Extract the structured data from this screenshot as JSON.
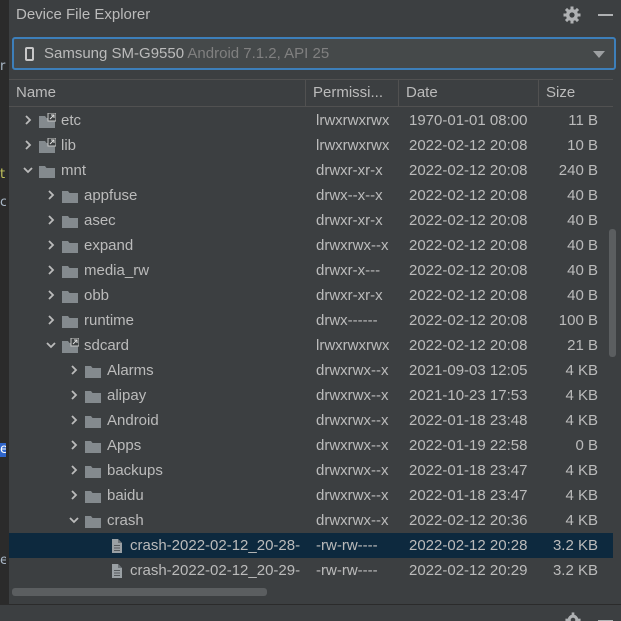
{
  "window": {
    "title": "Device File Explorer"
  },
  "device": {
    "name": "Samsung SM-G9550",
    "os": "Android 7.1.2, API 25"
  },
  "columns": {
    "name": "Name",
    "permissions": "Permissi...",
    "date": "Date",
    "size": "Size"
  },
  "left_strip": {
    "marks": [
      "r",
      "t",
      "c",
      "e",
      "e"
    ]
  },
  "rows": [
    {
      "indent": 0,
      "state": "collapsed",
      "icon": "folder-link-icon",
      "name": "etc",
      "permissions": "lrwxrwxrwx",
      "date": "1970-01-01 08:00",
      "size": "11 B"
    },
    {
      "indent": 0,
      "state": "collapsed",
      "icon": "folder-link-icon",
      "name": "lib",
      "permissions": "lrwxrwxrwx",
      "date": "2022-02-12 20:08",
      "size": "10 B"
    },
    {
      "indent": 0,
      "state": "expanded",
      "icon": "folder-icon",
      "name": "mnt",
      "permissions": "drwxr-xr-x",
      "date": "2022-02-12 20:08",
      "size": "240 B"
    },
    {
      "indent": 1,
      "state": "collapsed",
      "icon": "folder-icon",
      "name": "appfuse",
      "permissions": "drwx--x--x",
      "date": "2022-02-12 20:08",
      "size": "40 B"
    },
    {
      "indent": 1,
      "state": "collapsed",
      "icon": "folder-icon",
      "name": "asec",
      "permissions": "drwxr-xr-x",
      "date": "2022-02-12 20:08",
      "size": "40 B"
    },
    {
      "indent": 1,
      "state": "collapsed",
      "icon": "folder-icon",
      "name": "expand",
      "permissions": "drwxrwx--x",
      "date": "2022-02-12 20:08",
      "size": "40 B"
    },
    {
      "indent": 1,
      "state": "collapsed",
      "icon": "folder-icon",
      "name": "media_rw",
      "permissions": "drwxr-x---",
      "date": "2022-02-12 20:08",
      "size": "40 B"
    },
    {
      "indent": 1,
      "state": "collapsed",
      "icon": "folder-icon",
      "name": "obb",
      "permissions": "drwxr-xr-x",
      "date": "2022-02-12 20:08",
      "size": "40 B"
    },
    {
      "indent": 1,
      "state": "collapsed",
      "icon": "folder-icon",
      "name": "runtime",
      "permissions": "drwx------",
      "date": "2022-02-12 20:08",
      "size": "100 B"
    },
    {
      "indent": 1,
      "state": "expanded",
      "icon": "folder-link-icon",
      "name": "sdcard",
      "permissions": "lrwxrwxrwx",
      "date": "2022-02-12 20:08",
      "size": "21 B"
    },
    {
      "indent": 2,
      "state": "collapsed",
      "icon": "folder-icon",
      "name": "Alarms",
      "permissions": "drwxrwx--x",
      "date": "2021-09-03 12:05",
      "size": "4 KB"
    },
    {
      "indent": 2,
      "state": "collapsed",
      "icon": "folder-icon",
      "name": "alipay",
      "permissions": "drwxrwx--x",
      "date": "2021-10-23 17:53",
      "size": "4 KB"
    },
    {
      "indent": 2,
      "state": "collapsed",
      "icon": "folder-icon",
      "name": "Android",
      "permissions": "drwxrwx--x",
      "date": "2022-01-18 23:48",
      "size": "4 KB"
    },
    {
      "indent": 2,
      "state": "collapsed",
      "icon": "folder-icon",
      "name": "Apps",
      "permissions": "drwxrwx--x",
      "date": "2022-01-19 22:58",
      "size": "0 B"
    },
    {
      "indent": 2,
      "state": "collapsed",
      "icon": "folder-icon",
      "name": "backups",
      "permissions": "drwxrwx--x",
      "date": "2022-01-18 23:47",
      "size": "4 KB"
    },
    {
      "indent": 2,
      "state": "collapsed",
      "icon": "folder-icon",
      "name": "baidu",
      "permissions": "drwxrwx--x",
      "date": "2022-01-18 23:47",
      "size": "4 KB"
    },
    {
      "indent": 2,
      "state": "expanded",
      "icon": "folder-icon",
      "name": "crash",
      "permissions": "drwxrwx--x",
      "date": "2022-02-12 20:36",
      "size": "4 KB"
    },
    {
      "indent": 3,
      "state": "leaf",
      "icon": "file-icon",
      "name": "crash-2022-02-12_20-28-",
      "permissions": "-rw-rw----",
      "date": "2022-02-12 20:28",
      "size": "3.2 KB",
      "selected": true
    },
    {
      "indent": 3,
      "state": "leaf",
      "icon": "file-icon",
      "name": "crash-2022-02-12_20-29-",
      "permissions": "-rw-rw----",
      "date": "2022-02-12 20:29",
      "size": "3.2 KB"
    }
  ],
  "colors": {
    "background": "#3c3f41",
    "selection": "#0d293e",
    "focus": "#3d7fba",
    "folder": "#848a8e"
  }
}
